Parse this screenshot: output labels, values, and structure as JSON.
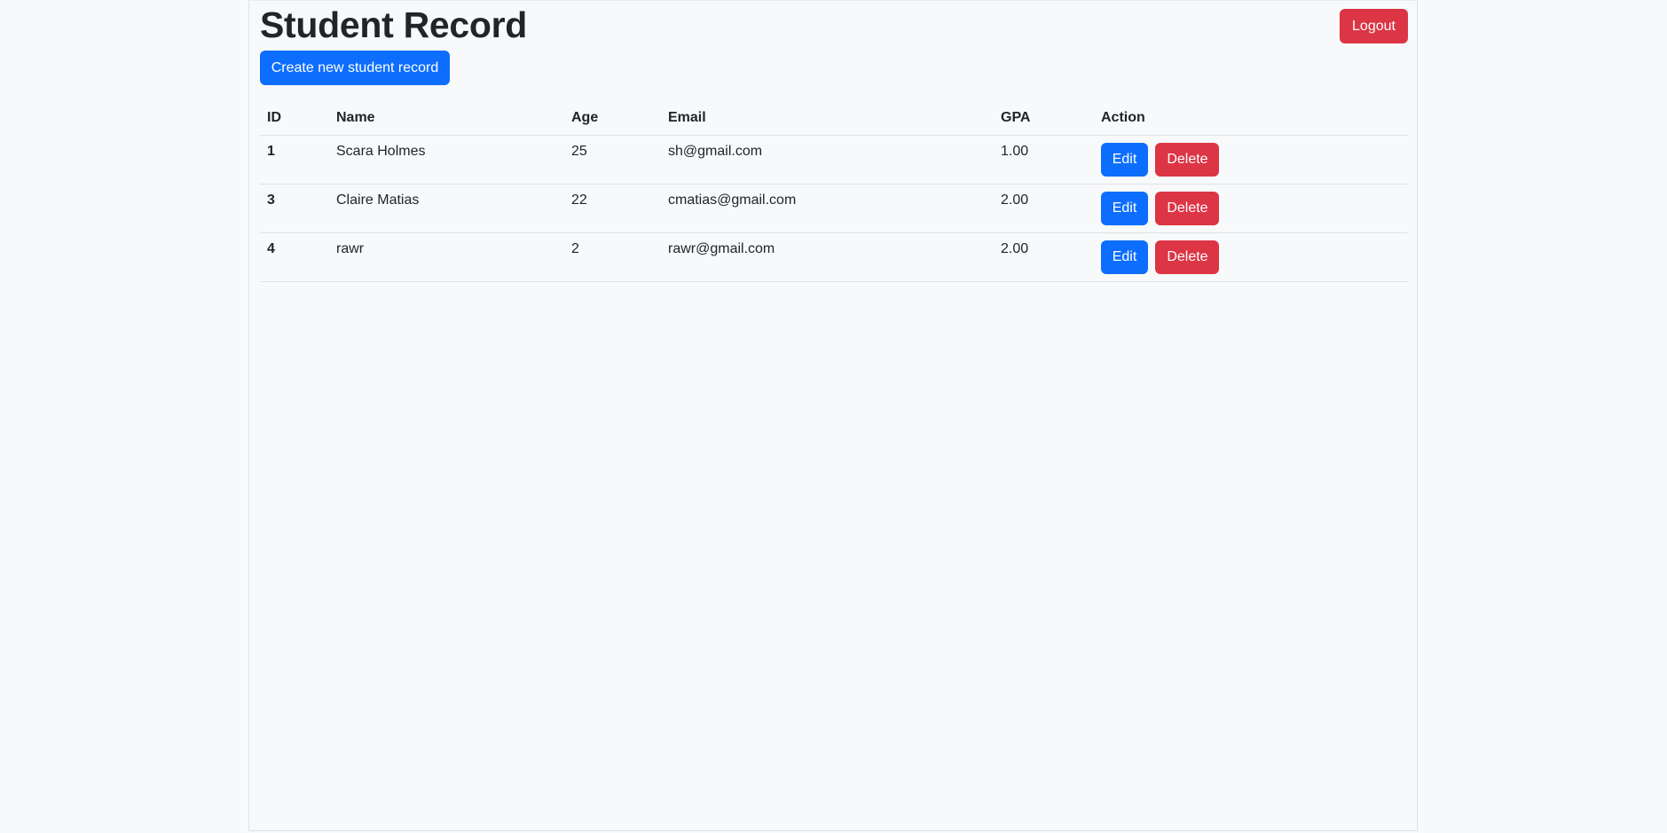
{
  "header": {
    "title": "Student Record",
    "logout_label": "Logout"
  },
  "toolbar": {
    "create_label": "Create new student record"
  },
  "table": {
    "columns": [
      "ID",
      "Name",
      "Age",
      "Email",
      "GPA",
      "Action"
    ],
    "rows": [
      {
        "id": "1",
        "name": "Scara Holmes",
        "age": "25",
        "email": "sh@gmail.com",
        "gpa": "1.00"
      },
      {
        "id": "3",
        "name": "Claire Matias",
        "age": "22",
        "email": "cmatias@gmail.com",
        "gpa": "2.00"
      },
      {
        "id": "4",
        "name": "rawr",
        "age": "2",
        "email": "rawr@gmail.com",
        "gpa": "2.00"
      }
    ],
    "edit_label": "Edit",
    "delete_label": "Delete"
  },
  "colors": {
    "primary": "#0d6efd",
    "danger": "#dc3545",
    "background": "#f8f9fa"
  }
}
